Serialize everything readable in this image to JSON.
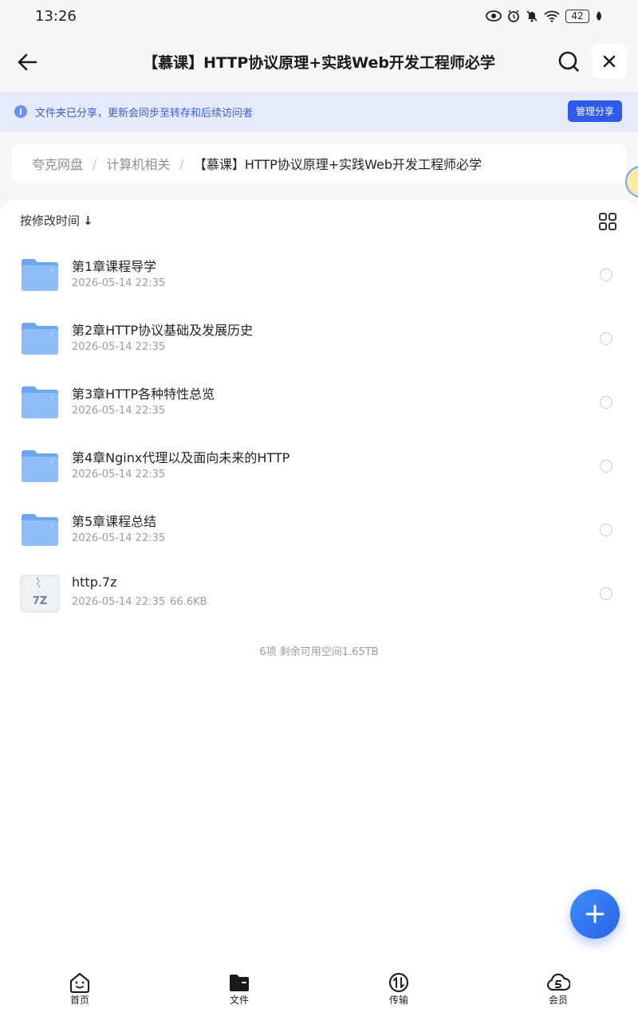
{
  "status_bar": {
    "time": "13:26",
    "battery": "42",
    "icons": [
      "eye-icon",
      "alarm-icon",
      "bell-off-icon",
      "wifi-icon",
      "battery-icon",
      "leaf-icon"
    ]
  },
  "header": {
    "title": "【慕课】HTTP协议原理+实践Web开发工程师必学",
    "back_icon": "arrow-left-icon",
    "search_icon": "search-icon",
    "close_icon": "close-icon"
  },
  "share_banner": {
    "text": "文件夹已分享，更新会同步至转存和后续访问者",
    "button_label": "管理分享",
    "info_icon": "i"
  },
  "breadcrumb": {
    "items": [
      "夸克网盘",
      "计算机相关"
    ],
    "current": "【慕课】HTTP协议原理+实践Web开发工程师必学",
    "separator": "/"
  },
  "sort": {
    "label": "按修改时间",
    "arrow": "↓"
  },
  "files": [
    {
      "name": "第1章课程导学",
      "date": "2026-05-14 22:35",
      "size": "",
      "type": "folder"
    },
    {
      "name": "第2章HTTP协议基础及发展历史",
      "date": "2026-05-14 22:35",
      "size": "",
      "type": "folder"
    },
    {
      "name": "第3章HTTP各种特性总览",
      "date": "2026-05-14 22:35",
      "size": "",
      "type": "folder"
    },
    {
      "name": "第4章Nginx代理以及面向未来的HTTP",
      "date": "2026-05-14 22:35",
      "size": "",
      "type": "folder"
    },
    {
      "name": "第5章课程总结",
      "date": "2026-05-14 22:35",
      "size": "",
      "type": "folder"
    },
    {
      "name": "http.7z",
      "date": "2026-05-14 22:35",
      "size": "66.6KB",
      "type": "archive",
      "badge": "7Z"
    }
  ],
  "summary": "6项 剩余可用空间1.65TB",
  "bottom_nav": [
    {
      "label": "首页",
      "icon": "home-face-icon"
    },
    {
      "label": "文件",
      "icon": "folder-icon"
    },
    {
      "label": "传输",
      "icon": "transfer-icon"
    },
    {
      "label": "会员",
      "icon": "cloud-vip-icon"
    }
  ],
  "colors": {
    "accent": "#2f5bea",
    "banner_bg": "#e6ebfb",
    "folder": "#7fb3f5",
    "page_bg": "#f5f6f8"
  }
}
